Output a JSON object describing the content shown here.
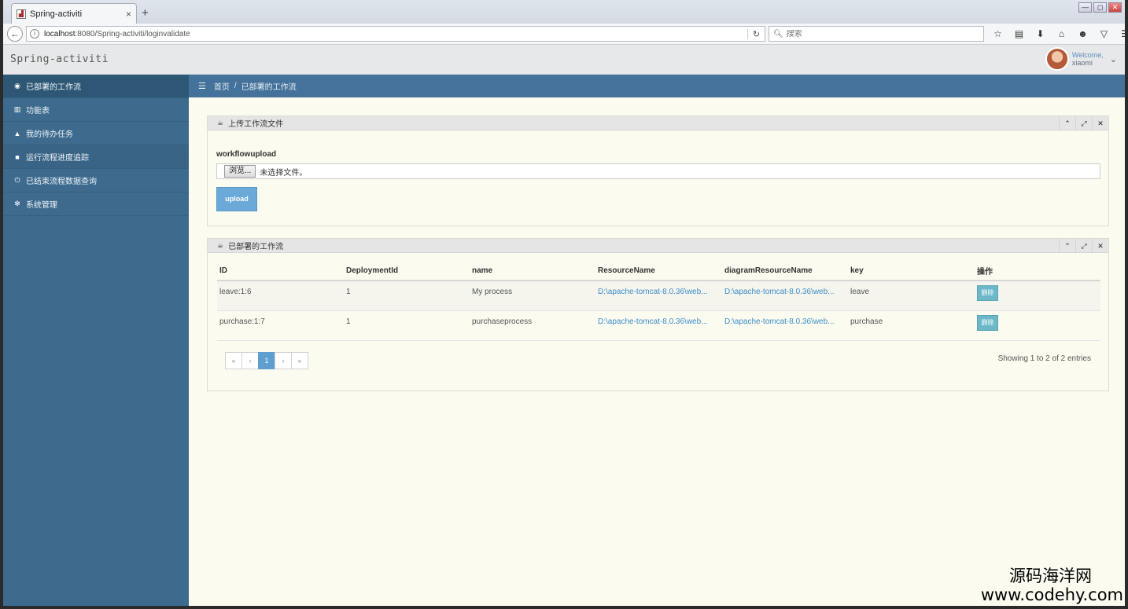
{
  "browser": {
    "tab_title": "Spring-activiti",
    "tab_close": "×",
    "new_tab": "+",
    "url_host": "localhost",
    "url_rest": ":8080/Spring-activiti/loginvalidate",
    "search_placeholder": "搜索",
    "window_buttons": [
      "—",
      "◻",
      "✕"
    ]
  },
  "app": {
    "brand": "Spring-activiti",
    "user": {
      "welcome": "Welcome,",
      "name": "xiaomi"
    }
  },
  "sidebar": {
    "items": [
      {
        "icon": "dashboard-icon",
        "glyph": "◉",
        "label": "已部署的工作流"
      },
      {
        "icon": "bar-chart-icon",
        "glyph": "▥",
        "label": "功能表"
      },
      {
        "icon": "bell-icon",
        "glyph": "▲",
        "label": "我的待办任务"
      },
      {
        "icon": "truck-icon",
        "glyph": "■",
        "label": "运行流程进度追踪"
      },
      {
        "icon": "power-icon",
        "glyph": "⏻",
        "label": "已结束流程数据查询"
      },
      {
        "icon": "gear-icon",
        "glyph": "✻",
        "label": "系统管理"
      }
    ]
  },
  "breadcrumb": {
    "home": "首页",
    "separator": "/",
    "current": "已部署的工作流"
  },
  "upload_panel": {
    "title": "上传工作流文件",
    "field_label": "workflowupload",
    "browse_label": "浏览...",
    "no_file": "未选择文件。",
    "upload_button": "upload"
  },
  "table_panel": {
    "title": "已部署的工作流",
    "columns": [
      "ID",
      "DeploymentId",
      "name",
      "ResourceName",
      "diagramResourceName",
      "key",
      "操作"
    ],
    "rows": [
      {
        "id": "leave:1:6",
        "deployment_id": "1",
        "name": "My process",
        "resource": "D:\\apache-tomcat-8.0.36\\web...",
        "diagram": "D:\\apache-tomcat-8.0.36\\web...",
        "key": "leave",
        "action": "删除"
      },
      {
        "id": "purchase:1:7",
        "deployment_id": "1",
        "name": "purchaseprocess",
        "resource": "D:\\apache-tomcat-8.0.36\\web...",
        "diagram": "D:\\apache-tomcat-8.0.36\\web...",
        "key": "purchase",
        "action": "删除"
      }
    ],
    "pager": {
      "first": "«",
      "prev": "‹",
      "current": "1",
      "next": "›",
      "last": "»"
    },
    "entries_text": "Showing 1 to 2 of 2 entries"
  },
  "panel_controls": {
    "collapse": "⌃",
    "expand": "⤢",
    "close": "✕"
  },
  "watermark": {
    "line1": "源码海洋网",
    "line2": "www.codehy.com"
  }
}
